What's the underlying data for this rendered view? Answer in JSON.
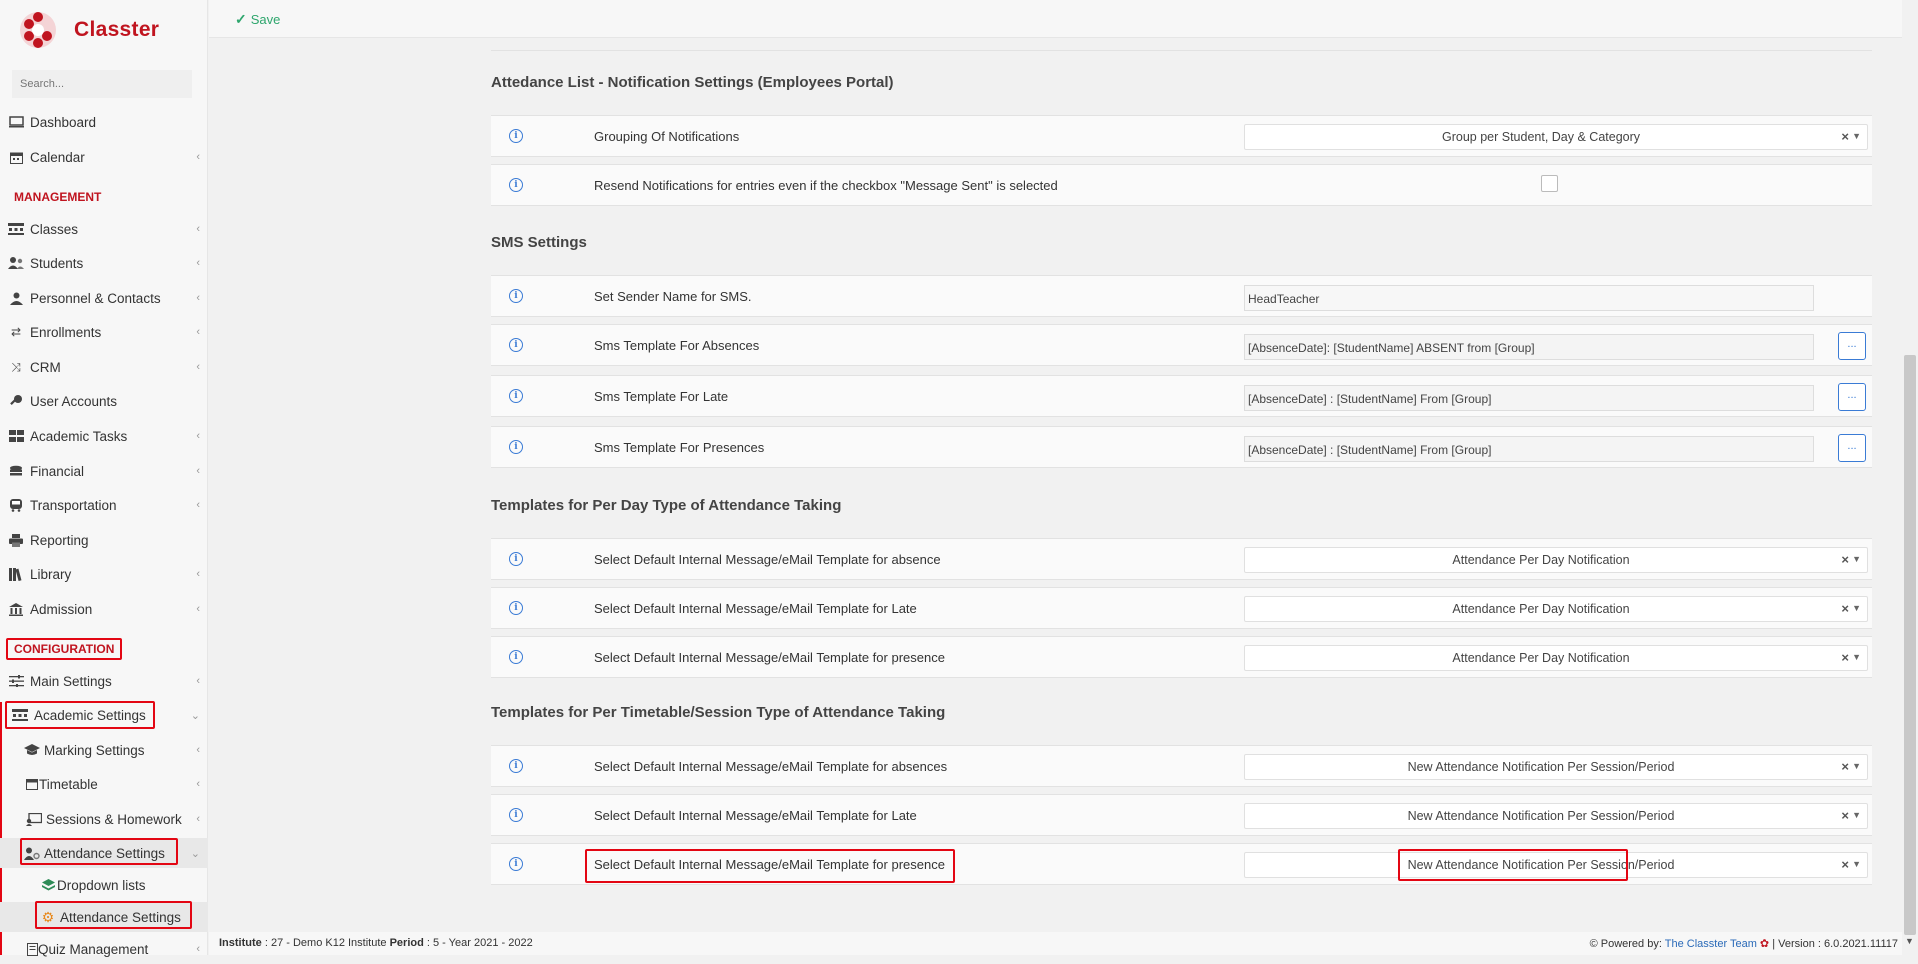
{
  "brand": {
    "name": "Classter"
  },
  "sidebar": {
    "search_placeholder": "Search...",
    "items_top": [
      {
        "label": "Dashboard",
        "icon": "monitor-icon"
      },
      {
        "label": "Calendar",
        "icon": "calendar-icon"
      }
    ],
    "management_header": "MANAGEMENT",
    "management_items": [
      {
        "label": "Classes",
        "icon": "classes-icon"
      },
      {
        "label": "Students",
        "icon": "students-icon"
      },
      {
        "label": "Personnel & Contacts",
        "icon": "personnel-icon"
      },
      {
        "label": "Enrollments",
        "icon": "enrollments-icon"
      },
      {
        "label": "CRM",
        "icon": "crm-icon"
      },
      {
        "label": "User Accounts",
        "icon": "key-icon"
      },
      {
        "label": "Academic Tasks",
        "icon": "tasks-icon"
      },
      {
        "label": "Financial",
        "icon": "coins-icon"
      },
      {
        "label": "Transportation",
        "icon": "bus-icon"
      },
      {
        "label": "Reporting",
        "icon": "printer-icon"
      },
      {
        "label": "Library",
        "icon": "books-icon"
      },
      {
        "label": "Admission",
        "icon": "building-icon"
      }
    ],
    "configuration_header": "CONFIGURATION",
    "configuration_items": [
      {
        "label": "Main Settings",
        "icon": "sliders-icon"
      },
      {
        "label": "Academic Settings",
        "icon": "classes-icon"
      },
      {
        "label": "Marking Settings",
        "icon": "graduation-cap-icon"
      },
      {
        "label": "Timetable",
        "icon": "calendar-icon"
      },
      {
        "label": "Sessions & Homework",
        "icon": "board-icon"
      },
      {
        "label": "Attendance Settings",
        "icon": "user-gear-icon"
      },
      {
        "label": "Dropdown lists",
        "icon": "layers-icon"
      },
      {
        "label": "Attendance Settings",
        "icon": "gear-icon"
      },
      {
        "label": "Quiz Management",
        "icon": "quiz-icon"
      }
    ]
  },
  "toolbar": {
    "save_label": "Save"
  },
  "sections": {
    "notif_title": "Attedance List - Notification Settings (Employees Portal)",
    "grouping_label": "Grouping Of Notifications",
    "grouping_value": "Group per Student, Day & Category",
    "resend_label": "Resend Notifications for entries even if the checkbox \"Message Sent\" is selected",
    "sms_title": "SMS Settings",
    "sender_label": "Set Sender Name for SMS.",
    "sender_value": "HeadTeacher",
    "absences_label": "Sms Template For Absences",
    "absences_value": "[AbsenceDate]: [StudentName] ABSENT from [Group]",
    "late_label": "Sms Template For Late",
    "late_value": "[AbsenceDate] : [StudentName] From [Group]",
    "presences_label": "Sms Template For Presences",
    "presences_value": "[AbsenceDate] : [StudentName] From [Group]",
    "dots": "...",
    "perday_title": "Templates for Per Day Type of Attendance Taking",
    "perday_absence_label": "Select Default Internal Message/eMail Template for absence",
    "perday_late_label": "Select Default Internal Message/eMail Template for Late",
    "perday_presence_label": "Select Default Internal Message/eMail Template for presence",
    "perday_value": "Attendance Per Day Notification",
    "session_title": "Templates for Per Timetable/Session Type of Attendance Taking",
    "session_absences_label": "Select Default Internal Message/eMail Template for absences",
    "session_late_label": "Select Default Internal Message/eMail Template for Late",
    "session_presence_label": "Select Default Internal Message/eMail Template for presence",
    "session_value": "New Attendance Notification Per Session/Period"
  },
  "footer": {
    "institute_label": "Institute",
    "institute_value": ": 27 - Demo K12 Institute",
    "period_label": "Period",
    "period_value": ": 5 - Year 2021 - 2022",
    "powered_by": "Powered by:",
    "team": "The Classter Team",
    "version": "| Version : 6.0.2021.11117"
  },
  "colors": {
    "brand_red": "#c0141f",
    "highlight_red": "#e30613",
    "save_green": "#2ea66d",
    "info_blue": "#3a7bd5"
  }
}
